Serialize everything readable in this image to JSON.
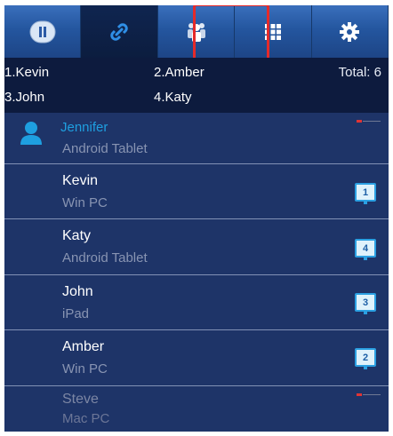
{
  "toolbar": {
    "buttons": [
      {
        "icon": "pause-icon"
      },
      {
        "icon": "link-icon"
      },
      {
        "icon": "group-icon"
      },
      {
        "icon": "grid-icon"
      },
      {
        "icon": "gear-icon"
      }
    ]
  },
  "summary": {
    "names": [
      "1.Kevin",
      "2.Amber",
      "3.John",
      "4.Katy"
    ],
    "total": "Total: 6"
  },
  "users": [
    {
      "name": "Jennifer",
      "device": "Android Tablet",
      "kind": "self"
    },
    {
      "name": "Kevin",
      "device": "Win PC",
      "screen": "1"
    },
    {
      "name": "Katy",
      "device": "Android Tablet",
      "screen": "4"
    },
    {
      "name": "John",
      "device": "iPad",
      "screen": "3"
    },
    {
      "name": "Amber",
      "device": "Win PC",
      "screen": "2"
    },
    {
      "name": "Steve",
      "device": "Mac PC",
      "kind": "offline"
    }
  ],
  "colors": {
    "toolbar": "#2a5aa6",
    "list_background": "#1e3468",
    "highlight": "#e52a2a",
    "self_name": "#1e9fe0",
    "badge": "#2ba0e2"
  }
}
